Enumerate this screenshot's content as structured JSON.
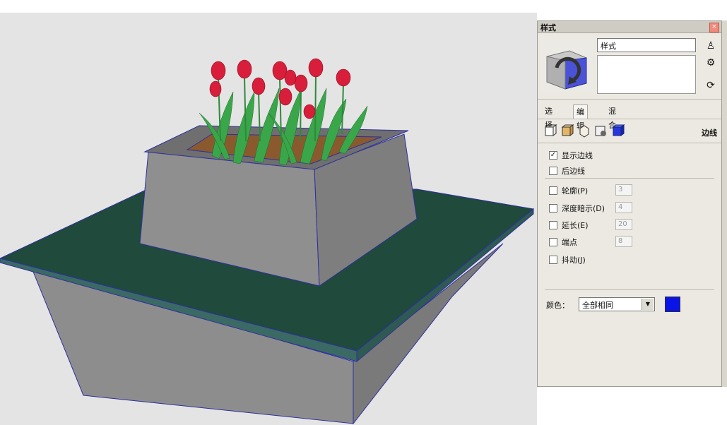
{
  "panel": {
    "title": "样式",
    "style_name": "样式",
    "tabs": [
      {
        "label": "选择",
        "active": false
      },
      {
        "label": "编辑",
        "active": true
      },
      {
        "label": "混合",
        "active": false
      }
    ],
    "section_label": "边线",
    "checkboxes": [
      {
        "label": "显示边线",
        "checked": true
      },
      {
        "label": "后边线",
        "checked": false
      },
      {
        "label": "轮廓(P)",
        "checked": false,
        "value": "3"
      },
      {
        "label": "深度暗示(D)",
        "checked": false,
        "value": "4"
      },
      {
        "label": "延长(E)",
        "checked": false,
        "value": "20"
      },
      {
        "label": "端点",
        "checked": false,
        "value": "8"
      },
      {
        "label": "抖动(J)",
        "checked": false
      }
    ],
    "color_label": "颜色：",
    "color_mode": "全部相同",
    "edge_color": "#0a14e6"
  },
  "viewport": {
    "background": "#e4e4e4",
    "description_icons": [
      "model-view"
    ]
  }
}
